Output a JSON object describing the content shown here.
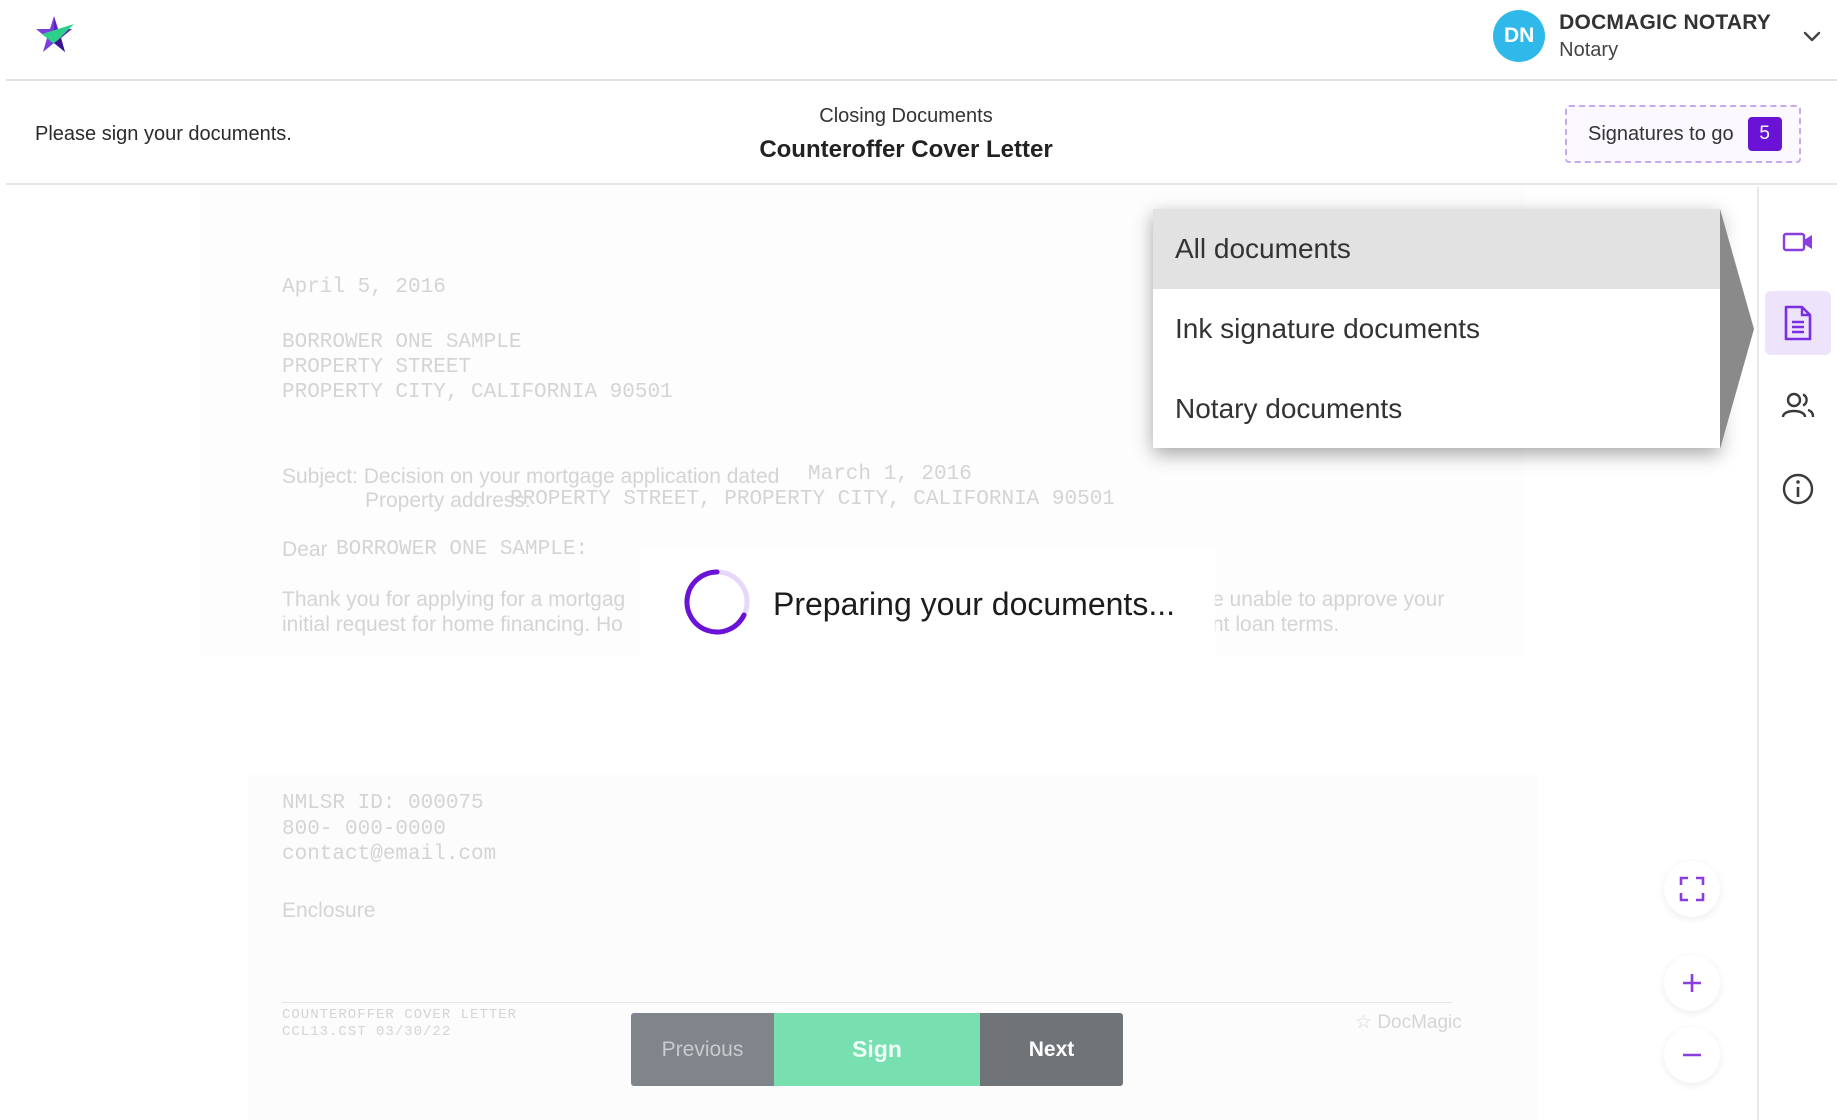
{
  "header": {
    "logo": "star-logo",
    "user": {
      "initials": "DN",
      "name": "DOCMAGIC NOTARY",
      "role": "Notary",
      "avatar_color": "#2fb8ea"
    }
  },
  "subheader": {
    "instruction": "Please sign your documents.",
    "category": "Closing Documents",
    "document_title": "Counteroffer Cover Letter",
    "signatures_label": "Signatures to go",
    "signatures_count": "5"
  },
  "document": {
    "date": "April 5, 2016",
    "address_lines": [
      "BORROWER ONE SAMPLE",
      "PROPERTY STREET",
      "PROPERTY CITY, CALIFORNIA 90501"
    ],
    "subject_prefix": "Subject: Decision on your mortgage application dated",
    "subject_date": "March 1, 2016",
    "property_label": "Property address:",
    "property_address": "PROPERTY STREET, PROPERTY CITY, CALIFORNIA 90501",
    "salutation_prefix": "Dear",
    "salutation_name": "BORROWER ONE SAMPLE:",
    "body_left_1": "Thank you for applying for a mortgag",
    "body_left_2": "initial request for home financing. Ho",
    "body_right_1": "e unable to approve your",
    "body_right_2": "nt loan terms.",
    "nmlsr": "NMLSR ID: 000075",
    "phone": "800- 000-0000",
    "email": "contact@email.com",
    "enclosure": "Enclosure",
    "footer_title": "COUNTEROFFER COVER LETTER",
    "footer_code": "CCL13.CST 03/30/22",
    "footer_brand": "DocMagic"
  },
  "loading": {
    "text": "Preparing your documents...",
    "spinner_color": "#6a13d6"
  },
  "navigation": {
    "previous": "Previous",
    "sign": "Sign",
    "next": "Next"
  },
  "dropdown": {
    "items": [
      "All documents",
      "Ink signature documents",
      "Notary documents"
    ],
    "selected": "All documents"
  },
  "sidebar": {
    "items": [
      "video-icon",
      "document-icon",
      "participants-icon",
      "info-icon"
    ],
    "active": "document-icon",
    "accent": "#8a3ee0"
  },
  "zoom": {
    "controls": [
      "fullscreen-icon",
      "zoom-in-icon",
      "zoom-out-icon"
    ]
  }
}
